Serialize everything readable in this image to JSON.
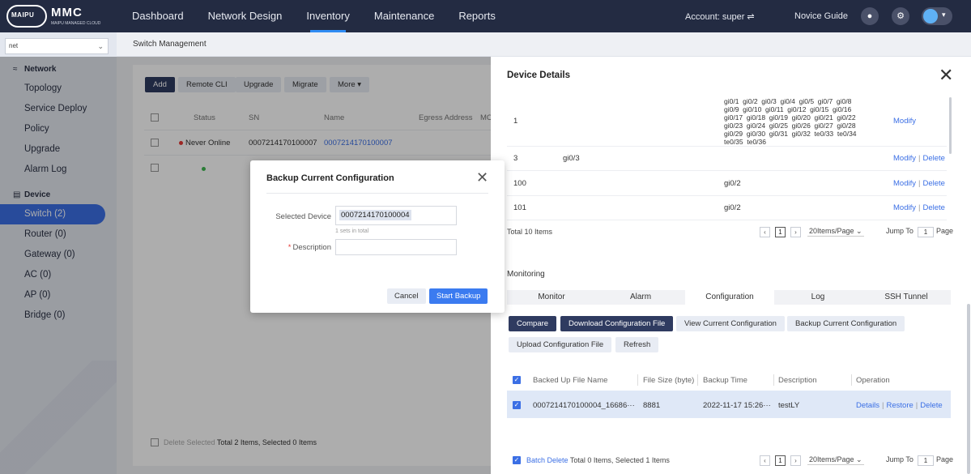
{
  "app": {
    "logo_text": "MAIPU",
    "logo_slogan": "MAKE IT INTELLIGENT",
    "title": "MMC",
    "subtitle": "MAIPU MANAGED CLOUD"
  },
  "nav": {
    "items": [
      "Dashboard",
      "Network Design",
      "Inventory",
      "Maintenance",
      "Reports"
    ],
    "active": "Inventory",
    "account": "Account: super ⇌",
    "novice_guide": "Novice Guide"
  },
  "sidebar": {
    "site": "net",
    "network_title": "Network",
    "network_items": [
      "Topology",
      "Service Deploy",
      "Policy",
      "Upgrade",
      "Alarm Log"
    ],
    "device_title": "Device",
    "device_items": [
      "Switch (2)",
      "Router (0)",
      "Gateway (0)",
      "AC (0)",
      "AP (0)",
      "Bridge (0)"
    ]
  },
  "breadcrumb": "Switch Management",
  "toolbar": {
    "add": "Add",
    "remote_cli": "Remote CLI",
    "upgrade": "Upgrade",
    "migrate": "Migrate",
    "more": "More ▾"
  },
  "table": {
    "headers": [
      "Status",
      "SN",
      "Name",
      "Egress Address",
      "MC"
    ],
    "rows": [
      {
        "status": "Never Online",
        "sn": "0007214170100007",
        "name": "0007214170100007"
      }
    ],
    "footer_delete": "Delete Selected",
    "footer_total": "Total 2 Items, Selected 0 Items"
  },
  "drawer": {
    "title": "Device Details",
    "vlan_rows": [
      {
        "id": "1",
        "ports": "gi0/1  gi0/2  gi0/3  gi0/4  gi0/5  gi0/7  gi0/8\ngi0/9  gi0/10  gi0/11  gi0/12  gi0/15  gi0/16\ngi0/17  gi0/18  gi0/19  gi0/20  gi0/21  gi0/22\ngi0/23  gi0/24  gi0/25  gi0/26  gi0/27  gi0/28\ngi0/29  gi0/30  gi0/31  gi0/32  te0/33  te0/34\nte0/35  te0/36",
        "ops": [
          "Modify"
        ]
      },
      {
        "id": "3",
        "tagged": "gi0/3",
        "ops": [
          "Modify",
          "Delete"
        ]
      },
      {
        "id": "100",
        "ports": "gi0/2",
        "ops": [
          "Modify",
          "Delete"
        ]
      },
      {
        "id": "101",
        "ports": "gi0/2",
        "ops": [
          "Modify",
          "Delete"
        ]
      }
    ],
    "pager1": {
      "total": "Total 10 Items",
      "page": "1",
      "per_page": "20Items/Page",
      "jump_to": "Jump To",
      "jump_value": "1",
      "page_word": "Page"
    },
    "monitoring": "Monitoring",
    "tabs": [
      "Monitor",
      "Alarm",
      "Configuration",
      "Log",
      "SSH Tunnel"
    ],
    "active_tab": "Configuration",
    "actions": [
      "Compare",
      "Download Configuration File",
      "View Current Configuration",
      "Backup Current Configuration"
    ],
    "actions2": [
      "Upload Configuration File",
      "Refresh"
    ],
    "backup_headers": [
      "Backed Up File Name",
      "File Size (byte)",
      "Backup Time",
      "Description",
      "Operation"
    ],
    "backup_rows": [
      {
        "file": "0007214170100004_16686···",
        "size": "8881",
        "time": "2022-11-17 15:26···",
        "desc": "testLY",
        "ops": [
          "Details",
          "Restore",
          "Delete"
        ]
      }
    ],
    "pager2": {
      "batch_delete": "Batch Delete",
      "total": "Total 0 Items, Selected 1 Items",
      "page": "1",
      "per_page": "20Items/Page",
      "jump_to": "Jump To",
      "jump_value": "1",
      "page_word": "Page"
    }
  },
  "modal": {
    "title": "Backup Current Configuration",
    "selected_device_label": "Selected Device",
    "selected_device_value": "0007214170100004",
    "hint": "1 sets in total",
    "description_label": "Description",
    "description_value": "",
    "cancel": "Cancel",
    "start": "Start Backup"
  }
}
